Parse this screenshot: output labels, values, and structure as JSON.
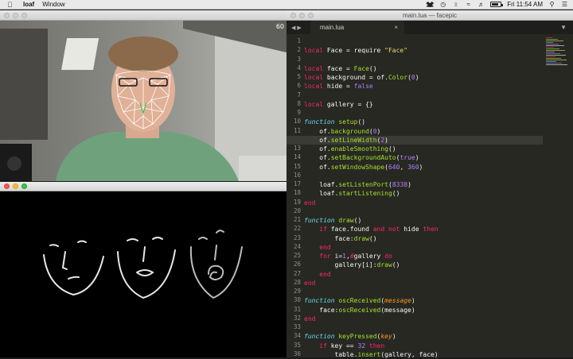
{
  "menubar": {
    "app_name": "loaf",
    "menu_window": "Window",
    "clock": "Fri 11:54 AM",
    "battery_level": 0.7,
    "icons": [
      "apple-icon",
      "dropbox-icon",
      "history-icon",
      "bluetooth-icon",
      "wifi-icon",
      "volume-icon",
      "battery-icon",
      "search-icon",
      "list-icon"
    ]
  },
  "camera_window": {
    "fps": "60"
  },
  "editor": {
    "title": "main.lua — facepic",
    "tab_label": "main.lua",
    "tab_close": "×",
    "nav_arrows": "◀ ▶",
    "menu_arrow": "▼",
    "current_line": 12,
    "lines": [
      {
        "n": "1",
        "parts": []
      },
      {
        "n": "2",
        "parts": [
          [
            "kw",
            "local"
          ],
          [
            "pl",
            " Face = "
          ],
          [
            "pl",
            "require "
          ],
          [
            "st",
            "\"Face\""
          ]
        ]
      },
      {
        "n": "3",
        "parts": []
      },
      {
        "n": "4",
        "parts": [
          [
            "kw",
            "local"
          ],
          [
            "pl",
            " face = "
          ],
          [
            "nm",
            "Face"
          ],
          [
            "pl",
            "()"
          ]
        ]
      },
      {
        "n": "5",
        "parts": [
          [
            "kw",
            "local"
          ],
          [
            "pl",
            " background = of."
          ],
          [
            "nm",
            "Color"
          ],
          [
            "pl",
            "("
          ],
          [
            "nu",
            "0"
          ],
          [
            "pl",
            ")"
          ]
        ]
      },
      {
        "n": "6",
        "parts": [
          [
            "kw",
            "local"
          ],
          [
            "pl",
            " hide = "
          ],
          [
            "nu",
            "false"
          ]
        ]
      },
      {
        "n": "7",
        "parts": []
      },
      {
        "n": "8",
        "parts": [
          [
            "kw",
            "local"
          ],
          [
            "pl",
            " gallery = {}"
          ]
        ]
      },
      {
        "n": "9",
        "parts": []
      },
      {
        "n": "10",
        "parts": [
          [
            "fn",
            "function"
          ],
          [
            "pl",
            " "
          ],
          [
            "nm",
            "setup"
          ],
          [
            "pl",
            "()"
          ]
        ]
      },
      {
        "n": "11",
        "parts": [
          [
            "pl",
            "    of."
          ],
          [
            "nm",
            "background"
          ],
          [
            "pl",
            "("
          ],
          [
            "nu",
            "0"
          ],
          [
            "pl",
            ")"
          ]
        ]
      },
      {
        "n": "12",
        "parts": [
          [
            "pl",
            "    of."
          ],
          [
            "nm",
            "setLineWidth"
          ],
          [
            "pl",
            "("
          ],
          [
            "nu",
            "2"
          ],
          [
            "pl",
            ")"
          ]
        ]
      },
      {
        "n": "13",
        "parts": [
          [
            "pl",
            "    of."
          ],
          [
            "nm",
            "enableSmoothing"
          ],
          [
            "pl",
            "()"
          ]
        ]
      },
      {
        "n": "14",
        "parts": [
          [
            "pl",
            "    of."
          ],
          [
            "nm",
            "setBackgroundAuto"
          ],
          [
            "pl",
            "("
          ],
          [
            "nu",
            "true"
          ],
          [
            "pl",
            ")"
          ]
        ]
      },
      {
        "n": "15",
        "parts": [
          [
            "pl",
            "    of."
          ],
          [
            "nm",
            "setWindowShape"
          ],
          [
            "pl",
            "("
          ],
          [
            "nu",
            "640"
          ],
          [
            "pl",
            ", "
          ],
          [
            "nu",
            "360"
          ],
          [
            "pl",
            ")"
          ]
        ]
      },
      {
        "n": "16",
        "parts": []
      },
      {
        "n": "17",
        "parts": [
          [
            "pl",
            "    loaf."
          ],
          [
            "nm",
            "setListenPort"
          ],
          [
            "pl",
            "("
          ],
          [
            "nu",
            "8338"
          ],
          [
            "pl",
            ")"
          ]
        ]
      },
      {
        "n": "18",
        "parts": [
          [
            "pl",
            "    loaf."
          ],
          [
            "nm",
            "startListening"
          ],
          [
            "pl",
            "()"
          ]
        ]
      },
      {
        "n": "19",
        "parts": [
          [
            "kw",
            "end"
          ]
        ]
      },
      {
        "n": "20",
        "parts": []
      },
      {
        "n": "21",
        "parts": [
          [
            "fn",
            "function"
          ],
          [
            "pl",
            " "
          ],
          [
            "nm",
            "draw"
          ],
          [
            "pl",
            "()"
          ]
        ]
      },
      {
        "n": "22",
        "parts": [
          [
            "pl",
            "    "
          ],
          [
            "kw",
            "if"
          ],
          [
            "pl",
            " face.found "
          ],
          [
            "kw",
            "and not"
          ],
          [
            "pl",
            " hide "
          ],
          [
            "kw",
            "then"
          ]
        ]
      },
      {
        "n": "23",
        "parts": [
          [
            "pl",
            "        face:"
          ],
          [
            "nm",
            "draw"
          ],
          [
            "pl",
            "()"
          ]
        ]
      },
      {
        "n": "24",
        "parts": [
          [
            "pl",
            "    "
          ],
          [
            "kw",
            "end"
          ]
        ]
      },
      {
        "n": "25",
        "parts": [
          [
            "pl",
            "    "
          ],
          [
            "kw",
            "for"
          ],
          [
            "pl",
            " i="
          ],
          [
            "nu",
            "1"
          ],
          [
            "pl",
            ","
          ],
          [
            "kw",
            "#"
          ],
          [
            "pl",
            "gallery "
          ],
          [
            "kw",
            "do"
          ]
        ]
      },
      {
        "n": "26",
        "parts": [
          [
            "pl",
            "        gallery[i]:"
          ],
          [
            "nm",
            "draw"
          ],
          [
            "pl",
            "()"
          ]
        ]
      },
      {
        "n": "27",
        "parts": [
          [
            "pl",
            "    "
          ],
          [
            "kw",
            "end"
          ]
        ]
      },
      {
        "n": "28",
        "parts": [
          [
            "kw",
            "end"
          ]
        ]
      },
      {
        "n": "29",
        "parts": []
      },
      {
        "n": "30",
        "parts": [
          [
            "fn",
            "function"
          ],
          [
            "pl",
            " "
          ],
          [
            "nm",
            "oscReceived"
          ],
          [
            "pl",
            "("
          ],
          [
            "pa",
            "message"
          ],
          [
            "pl",
            ")"
          ]
        ]
      },
      {
        "n": "31",
        "parts": [
          [
            "pl",
            "    face:"
          ],
          [
            "nm",
            "oscReceived"
          ],
          [
            "pl",
            "(message)"
          ]
        ]
      },
      {
        "n": "32",
        "parts": [
          [
            "kw",
            "end"
          ]
        ]
      },
      {
        "n": "33",
        "parts": []
      },
      {
        "n": "34",
        "parts": [
          [
            "fn",
            "function"
          ],
          [
            "pl",
            " "
          ],
          [
            "nm",
            "keyPressed"
          ],
          [
            "pl",
            "("
          ],
          [
            "pa",
            "key"
          ],
          [
            "pl",
            ")"
          ]
        ]
      },
      {
        "n": "35",
        "parts": [
          [
            "pl",
            "    "
          ],
          [
            "kw",
            "if"
          ],
          [
            "pl",
            " key == "
          ],
          [
            "nu",
            "32"
          ],
          [
            "pl",
            " "
          ],
          [
            "kw",
            "then"
          ]
        ]
      },
      {
        "n": "36",
        "parts": [
          [
            "pl",
            "        table."
          ],
          [
            "nm",
            "insert"
          ],
          [
            "pl",
            "(gallery, face)"
          ]
        ]
      }
    ]
  },
  "colors": {
    "editor_bg": "#272822",
    "keyword": "#f92672",
    "function": "#a6e22e",
    "string": "#e6db74",
    "number": "#ae81ff"
  }
}
